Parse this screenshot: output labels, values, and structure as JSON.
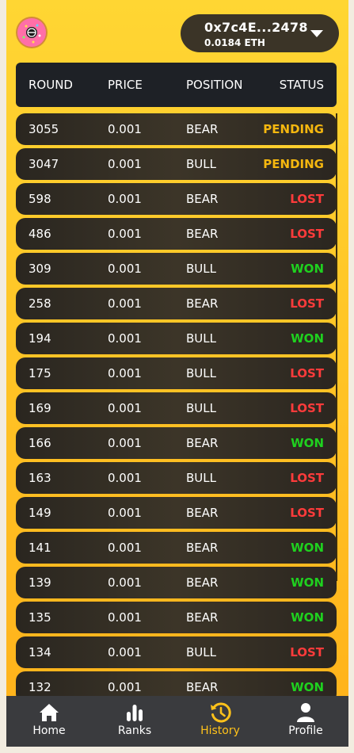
{
  "wallet": {
    "address": "0x7c4E...2478",
    "balance": "0.0184 ETH"
  },
  "table": {
    "headers": [
      "ROUND",
      "PRICE",
      "POSITION",
      "STATUS"
    ],
    "rows": [
      {
        "round": "3055",
        "price": "0.001",
        "position": "BEAR",
        "status": "PENDING"
      },
      {
        "round": "3047",
        "price": "0.001",
        "position": "BULL",
        "status": "PENDING"
      },
      {
        "round": "598",
        "price": "0.001",
        "position": "BEAR",
        "status": "LOST"
      },
      {
        "round": "486",
        "price": "0.001",
        "position": "BEAR",
        "status": "LOST"
      },
      {
        "round": "309",
        "price": "0.001",
        "position": "BULL",
        "status": "WON"
      },
      {
        "round": "258",
        "price": "0.001",
        "position": "BEAR",
        "status": "LOST"
      },
      {
        "round": "194",
        "price": "0.001",
        "position": "BULL",
        "status": "WON"
      },
      {
        "round": "175",
        "price": "0.001",
        "position": "BULL",
        "status": "LOST"
      },
      {
        "round": "169",
        "price": "0.001",
        "position": "BULL",
        "status": "LOST"
      },
      {
        "round": "166",
        "price": "0.001",
        "position": "BEAR",
        "status": "WON"
      },
      {
        "round": "163",
        "price": "0.001",
        "position": "BULL",
        "status": "LOST"
      },
      {
        "round": "149",
        "price": "0.001",
        "position": "BEAR",
        "status": "LOST"
      },
      {
        "round": "141",
        "price": "0.001",
        "position": "BEAR",
        "status": "WON"
      },
      {
        "round": "139",
        "price": "0.001",
        "position": "BEAR",
        "status": "WON"
      },
      {
        "round": "135",
        "price": "0.001",
        "position": "BEAR",
        "status": "WON"
      },
      {
        "round": "134",
        "price": "0.001",
        "position": "BULL",
        "status": "LOST"
      },
      {
        "round": "132",
        "price": "0.001",
        "position": "BEAR",
        "status": "WON"
      }
    ]
  },
  "status_colors": {
    "PENDING": "#f5b70f",
    "LOST": "#ff3b3b",
    "WON": "#1fd11f"
  },
  "nav": {
    "items": [
      {
        "label": "Home",
        "icon": "home-icon"
      },
      {
        "label": "Ranks",
        "icon": "bar-chart-icon"
      },
      {
        "label": "History",
        "icon": "history-icon"
      },
      {
        "label": "Profile",
        "icon": "user-icon"
      }
    ],
    "active": "History"
  }
}
